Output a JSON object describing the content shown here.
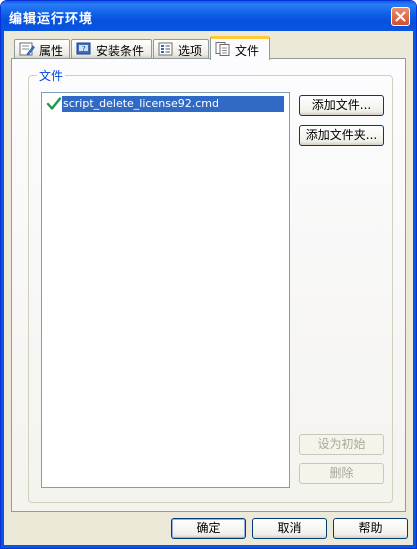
{
  "window": {
    "title": "编辑运行环境"
  },
  "tabs": [
    {
      "label": "属性",
      "icon": "properties-icon"
    },
    {
      "label": "安装条件",
      "icon": "install-conditions-icon"
    },
    {
      "label": "选项",
      "icon": "options-icon"
    },
    {
      "label": "文件",
      "icon": "files-icon",
      "active": true
    }
  ],
  "files_group": {
    "title": "文件",
    "items": [
      {
        "name": "script_delete_license92.cmd",
        "checked": true,
        "selected": true
      }
    ]
  },
  "side_buttons": {
    "add_file": "添加文件...",
    "add_folder": "添加文件夹...",
    "set_initial": "设为初始",
    "delete": "删除"
  },
  "footer_buttons": {
    "ok": "确定",
    "cancel": "取消",
    "help": "帮助"
  },
  "colors": {
    "title_bar": "#0a55e0",
    "selection": "#316ac5",
    "group_title": "#0046d5",
    "active_tab_accent": "#ffc83c",
    "dialog_bg": "#ece9d8"
  }
}
